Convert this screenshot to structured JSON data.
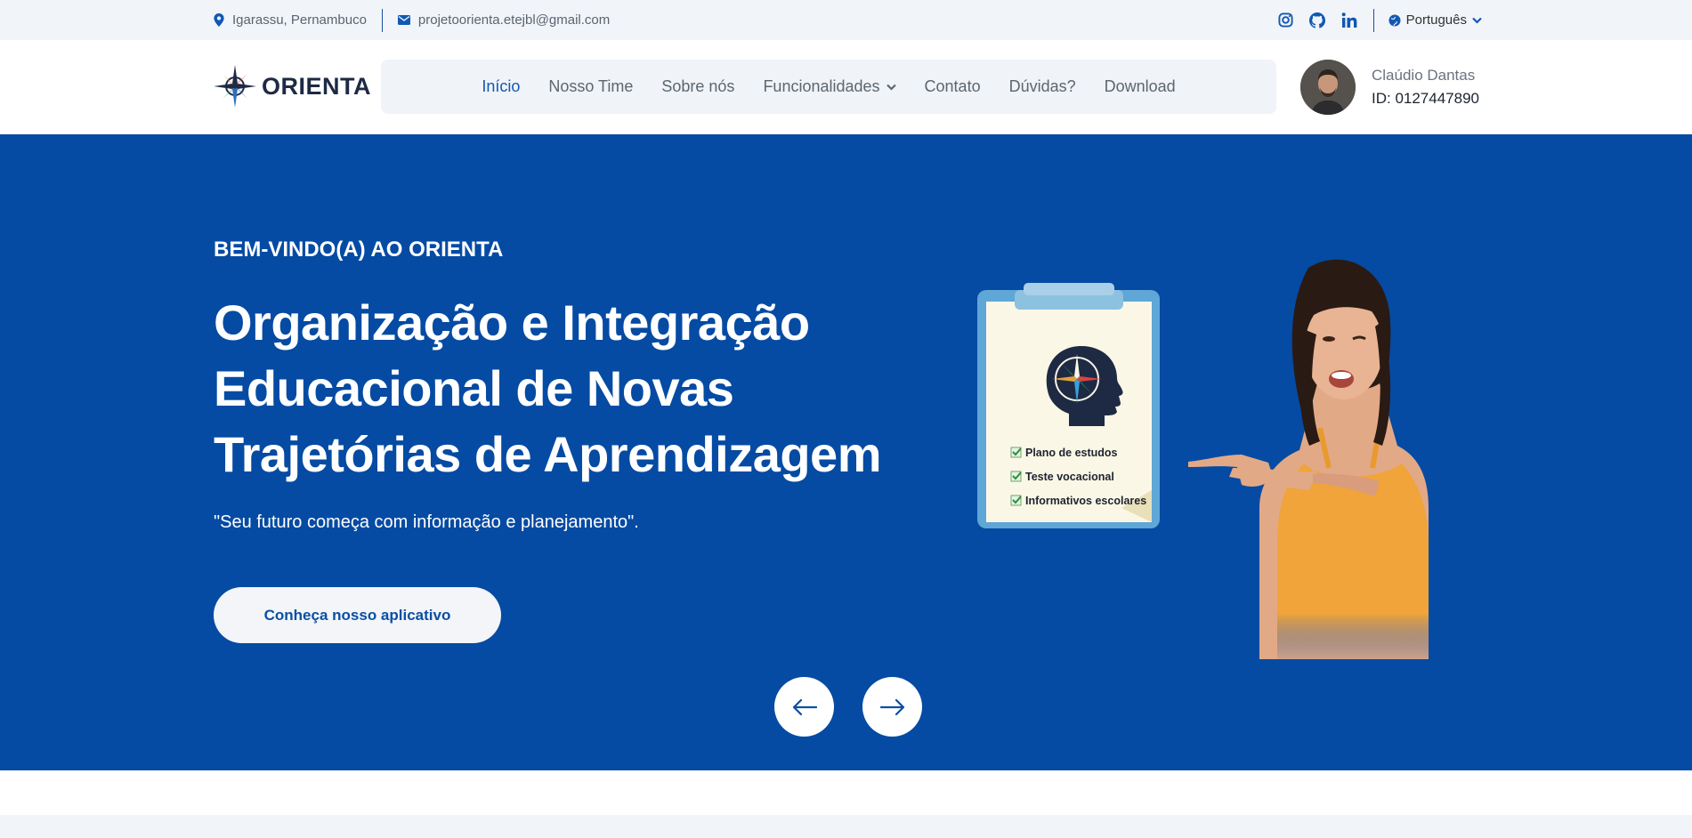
{
  "topbar": {
    "location": "Igarassu, Pernambuco",
    "email": "projetoorienta.etejbl@gmail.com",
    "socials": [
      "instagram-icon",
      "github-icon",
      "linkedin-icon"
    ],
    "language": "Português"
  },
  "navbar": {
    "logo_text": "ORIENTA",
    "menu": [
      {
        "label": "Início",
        "active": true
      },
      {
        "label": "Nosso Time"
      },
      {
        "label": "Sobre nós"
      },
      {
        "label": "Funcionalidades",
        "dropdown": true
      },
      {
        "label": "Contato"
      },
      {
        "label": "Dúvidas?"
      },
      {
        "label": "Download"
      }
    ]
  },
  "profile": {
    "name": "Claúdio Dantas",
    "id": "ID: 0127447890"
  },
  "hero": {
    "eyebrow": "BEM-VINDO(A) AO ORIENTA",
    "headline": "Organização e Integração Educacional de Novas Trajetórias de Aprendizagem",
    "tagline": "\"Seu futuro começa com informação e planejamento\".",
    "cta_label": "Conheça nosso aplicativo",
    "clipboard_items": [
      "Plano de estudos",
      "Teste vocacional",
      "Informativos escolares"
    ]
  },
  "colors": {
    "hero_bg": "#054ba3",
    "accent": "#1158b3",
    "topbar_bg": "#f1f4f8"
  }
}
